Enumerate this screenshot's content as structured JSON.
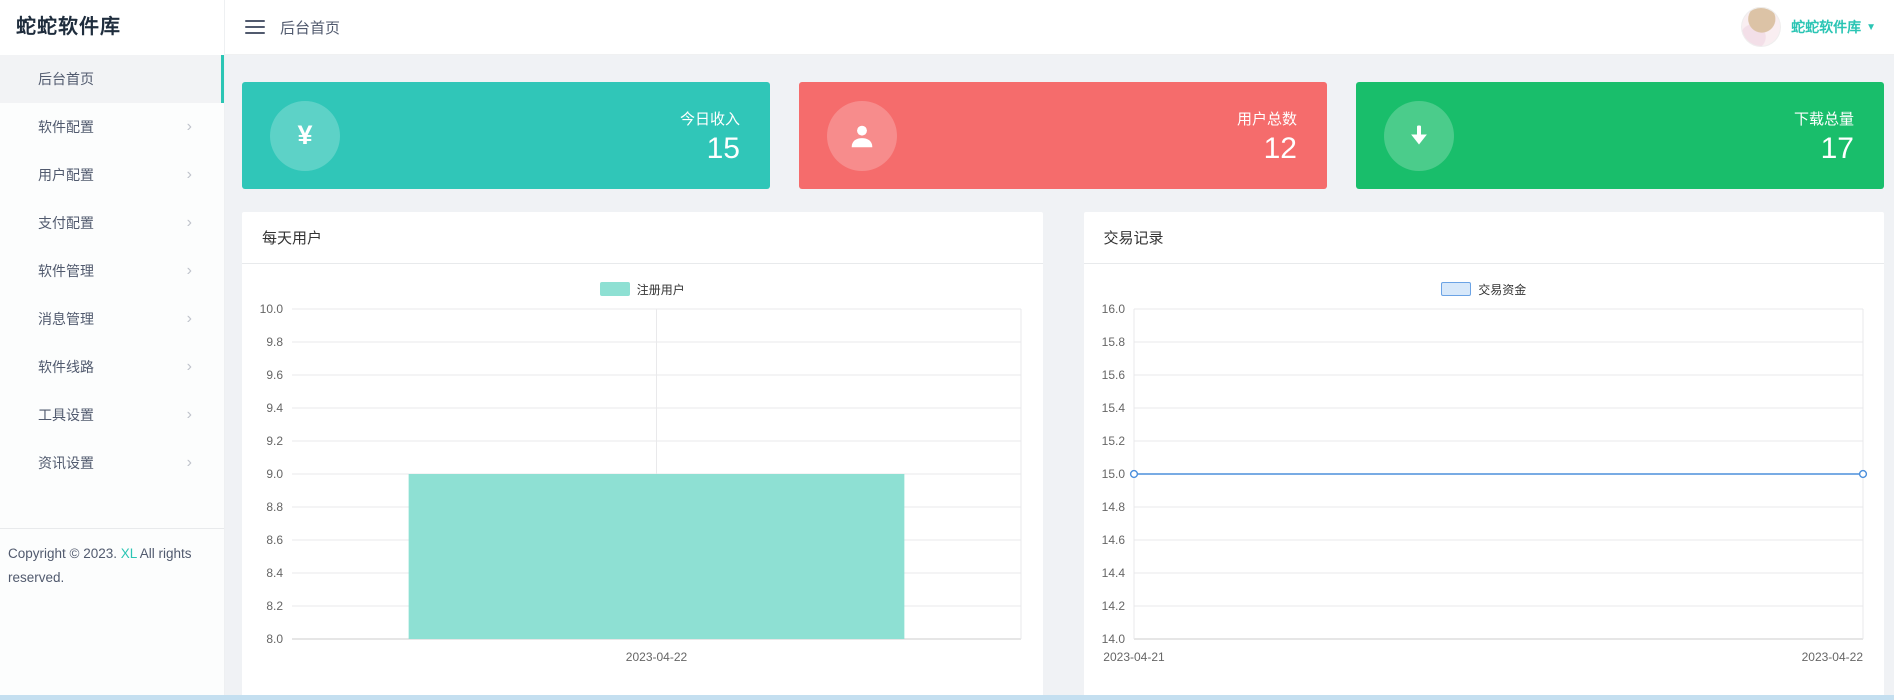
{
  "app": {
    "logo": "蛇蛇软件库"
  },
  "sidebar": {
    "items": [
      {
        "name": "home",
        "label": "后台首页",
        "active": true,
        "has_arrow": false
      },
      {
        "name": "software-config",
        "label": "软件配置",
        "active": false,
        "has_arrow": true
      },
      {
        "name": "user-config",
        "label": "用户配置",
        "active": false,
        "has_arrow": true
      },
      {
        "name": "payment-config",
        "label": "支付配置",
        "active": false,
        "has_arrow": true
      },
      {
        "name": "software-manage",
        "label": "软件管理",
        "active": false,
        "has_arrow": true
      },
      {
        "name": "message-manage",
        "label": "消息管理",
        "active": false,
        "has_arrow": true
      },
      {
        "name": "software-lines",
        "label": "软件线路",
        "active": false,
        "has_arrow": true
      },
      {
        "name": "tool-settings",
        "label": "工具设置",
        "active": false,
        "has_arrow": true
      },
      {
        "name": "news-settings",
        "label": "资讯设置",
        "active": false,
        "has_arrow": true
      }
    ],
    "copyright": {
      "prefix": "Copyright © 2023. ",
      "brand": "XL",
      "suffix": " All rights reserved."
    }
  },
  "header": {
    "breadcrumb": "后台首页",
    "user_name": "蛇蛇软件库"
  },
  "stats": [
    {
      "name": "income-today",
      "label": "今日收入",
      "value": "15",
      "color": "#30c6b8",
      "icon": "yen-icon"
    },
    {
      "name": "total-users",
      "label": "用户总数",
      "value": "12",
      "color": "#f56c6c",
      "icon": "user-icon"
    },
    {
      "name": "total-downloads",
      "label": "下载总量",
      "value": "17",
      "color": "#19be6b",
      "icon": "download-icon"
    }
  ],
  "chart_data": [
    {
      "type": "bar",
      "title": "每天用户",
      "legend": [
        "注册用户"
      ],
      "categories": [
        "2023-04-22"
      ],
      "series": [
        {
          "name": "注册用户",
          "values": [
            9
          ]
        }
      ],
      "ylim": [
        8.0,
        10.0
      ],
      "ytick_step": 0.2,
      "grid": true,
      "legend_position": "top-center",
      "colors": {
        "bar_fill": "#8ee0d3"
      },
      "legend_swatch": {
        "fill": "#8ee0d3",
        "border": "#8ee0d3"
      }
    },
    {
      "type": "line",
      "title": "交易记录",
      "legend": [
        "交易资金"
      ],
      "categories": [
        "2023-04-21",
        "2023-04-22"
      ],
      "series": [
        {
          "name": "交易资金",
          "values": [
            15,
            15
          ]
        }
      ],
      "ylim": [
        14.0,
        16.0
      ],
      "ytick_step": 0.2,
      "grid": true,
      "legend_position": "top-center",
      "colors": {
        "line": "#4b8fdc"
      },
      "legend_swatch": {
        "fill": "#d7e8fa",
        "border": "#6ba3e5"
      }
    }
  ]
}
